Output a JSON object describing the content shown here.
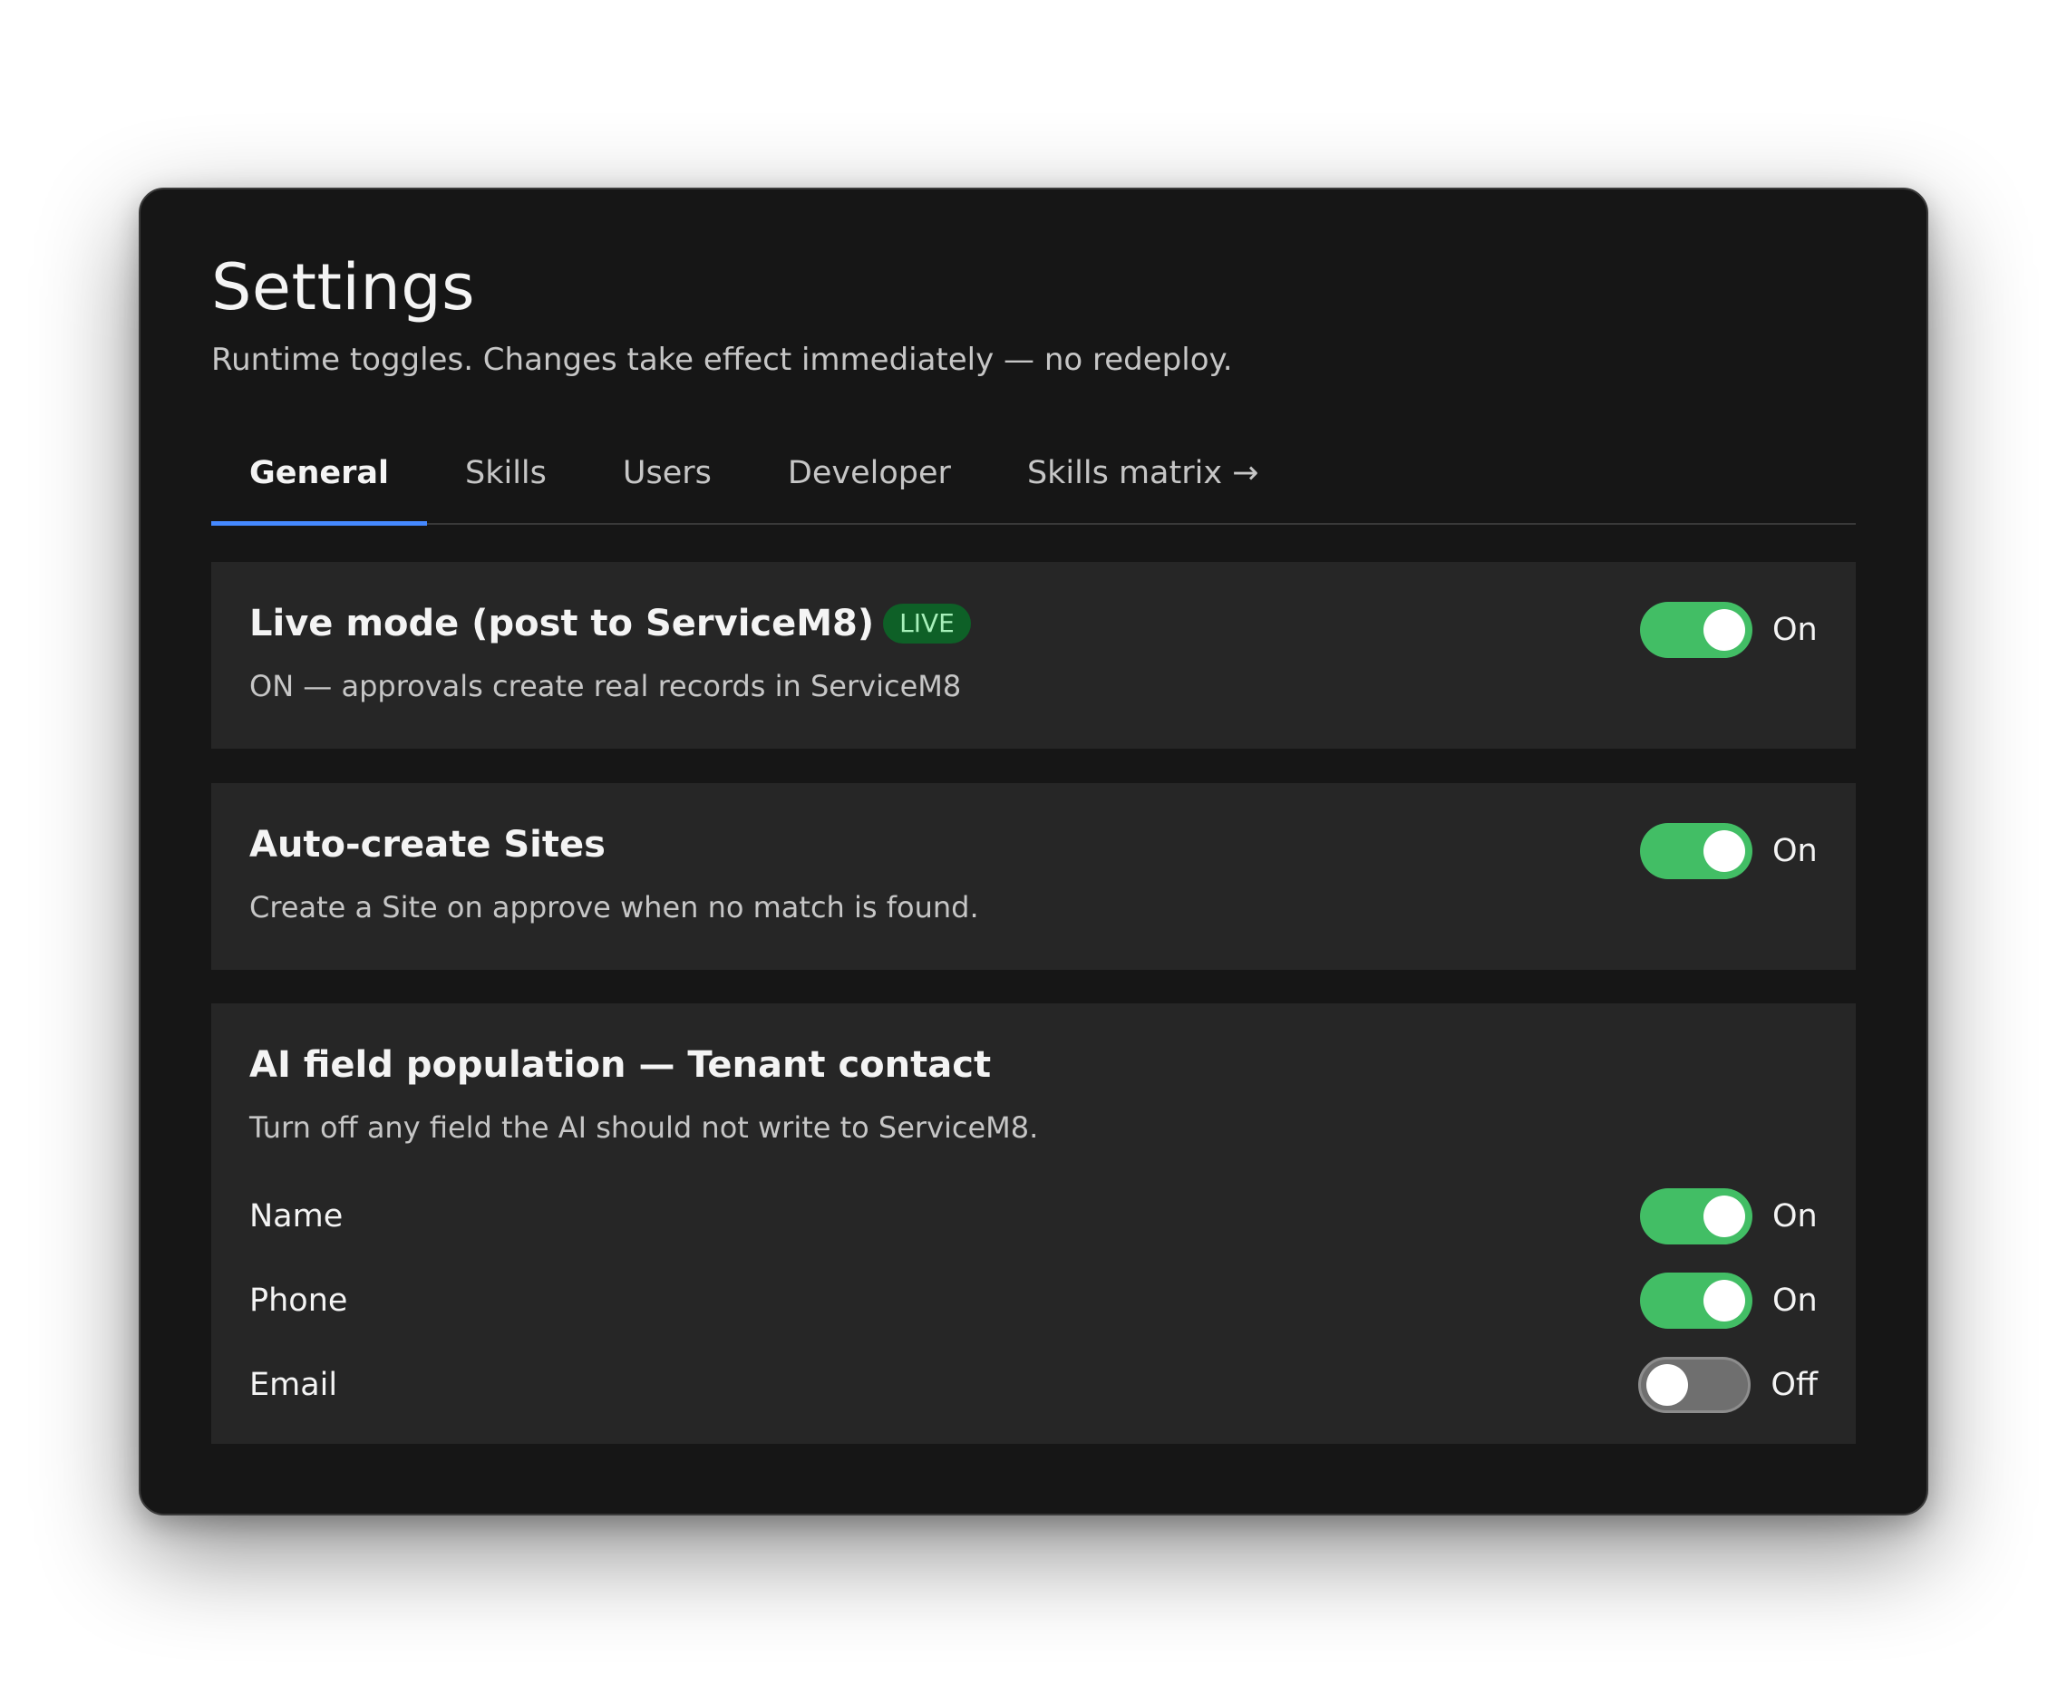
{
  "page": {
    "title": "Settings",
    "subtitle": "Runtime toggles. Changes take effect immediately — no redeploy."
  },
  "tabs": [
    {
      "label": "General",
      "active": true
    },
    {
      "label": "Skills",
      "active": false
    },
    {
      "label": "Users",
      "active": false
    },
    {
      "label": "Developer",
      "active": false
    },
    {
      "label": "Skills matrix →",
      "active": false
    }
  ],
  "live_mode": {
    "title": "Live mode (post to ServiceM8)",
    "badge": "LIVE",
    "description": "ON — approvals create real records in ServiceM8",
    "toggle_state": "On"
  },
  "auto_create_sites": {
    "title": "Auto-create Sites",
    "description": "Create a Site on approve when no match is found.",
    "toggle_state": "On"
  },
  "ai_field_population": {
    "title": "AI field population — Tenant contact",
    "description": "Turn off any field the AI should not write to ServiceM8.",
    "fields": [
      {
        "label": "Name",
        "state": "On"
      },
      {
        "label": "Phone",
        "state": "On"
      },
      {
        "label": "Email",
        "state": "Off"
      }
    ]
  },
  "colors": {
    "window_bg": "#161616",
    "card_bg": "#262626",
    "accent_tab": "#4589ff",
    "toggle_on": "#42be65",
    "toggle_off": "#6f6f6f",
    "badge_bg": "#0e6027",
    "badge_text": "#a7f0ba"
  }
}
